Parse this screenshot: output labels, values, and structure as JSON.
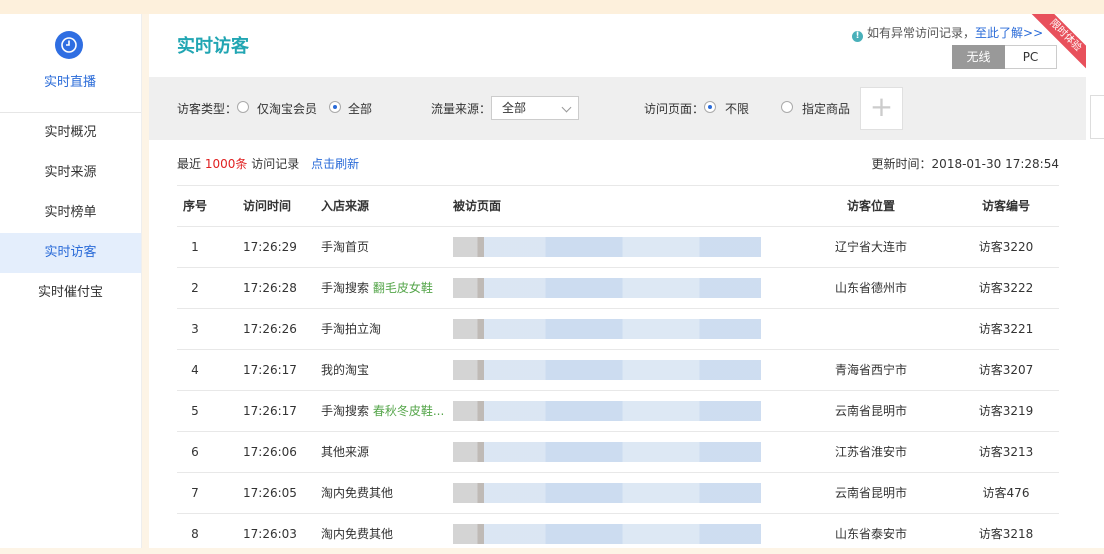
{
  "sidebar": {
    "title": "实时直播",
    "items": [
      {
        "label": "实时概况"
      },
      {
        "label": "实时来源"
      },
      {
        "label": "实时榜单"
      },
      {
        "label": "实时访客"
      },
      {
        "label": "实时催付宝"
      }
    ]
  },
  "header": {
    "page_title": "实时访客",
    "notice_text": "如有异常访问记录，",
    "notice_link": "至此了解>>",
    "ribbon": "限时体验",
    "switch": {
      "wireless": "无线",
      "pc": "PC"
    }
  },
  "filters": {
    "visitor_type_label": "访客类型：",
    "visitor_opt1": "仅淘宝会员",
    "visitor_opt2": "全部",
    "source_label": "流量来源：",
    "source_value": "全部",
    "page_label": "访问页面：",
    "page_opt1": "不限",
    "page_opt2": "指定商品",
    "add_symbol": "+"
  },
  "summary": {
    "prefix": "最近",
    "count": "1000条",
    "suffix": "访问记录",
    "refresh": "点击刷新",
    "update_label": "更新时间：",
    "update_time": "2018-01-30 17:28:54"
  },
  "table": {
    "headers": {
      "no": "序号",
      "time": "访问时间",
      "source": "入店来源",
      "page": "被访页面",
      "location": "访客位置",
      "visitor": "访客编号"
    },
    "rows": [
      {
        "no": "1",
        "time": "17:26:29",
        "source": "手淘首页",
        "keyword": "",
        "location": "辽宁省大连市",
        "visitor": "访客3220"
      },
      {
        "no": "2",
        "time": "17:26:28",
        "source": "手淘搜索",
        "keyword": "翻毛皮女鞋",
        "location": "山东省德州市",
        "visitor": "访客3222"
      },
      {
        "no": "3",
        "time": "17:26:26",
        "source": "手淘拍立淘",
        "keyword": "",
        "location": "",
        "visitor": "访客3221"
      },
      {
        "no": "4",
        "time": "17:26:17",
        "source": "我的淘宝",
        "keyword": "",
        "location": "青海省西宁市",
        "visitor": "访客3207"
      },
      {
        "no": "5",
        "time": "17:26:17",
        "source": "手淘搜索",
        "keyword": "春秋冬皮鞋...",
        "location": "云南省昆明市",
        "visitor": "访客3219"
      },
      {
        "no": "6",
        "time": "17:26:06",
        "source": "其他来源",
        "keyword": "",
        "location": "江苏省淮安市",
        "visitor": "访客3213"
      },
      {
        "no": "7",
        "time": "17:26:05",
        "source": "淘内免费其他",
        "keyword": "",
        "location": "云南省昆明市",
        "visitor": "访客476"
      },
      {
        "no": "8",
        "time": "17:26:03",
        "source": "淘内免费其他",
        "keyword": "",
        "location": "山东省泰安市",
        "visitor": "访客3218"
      }
    ]
  }
}
